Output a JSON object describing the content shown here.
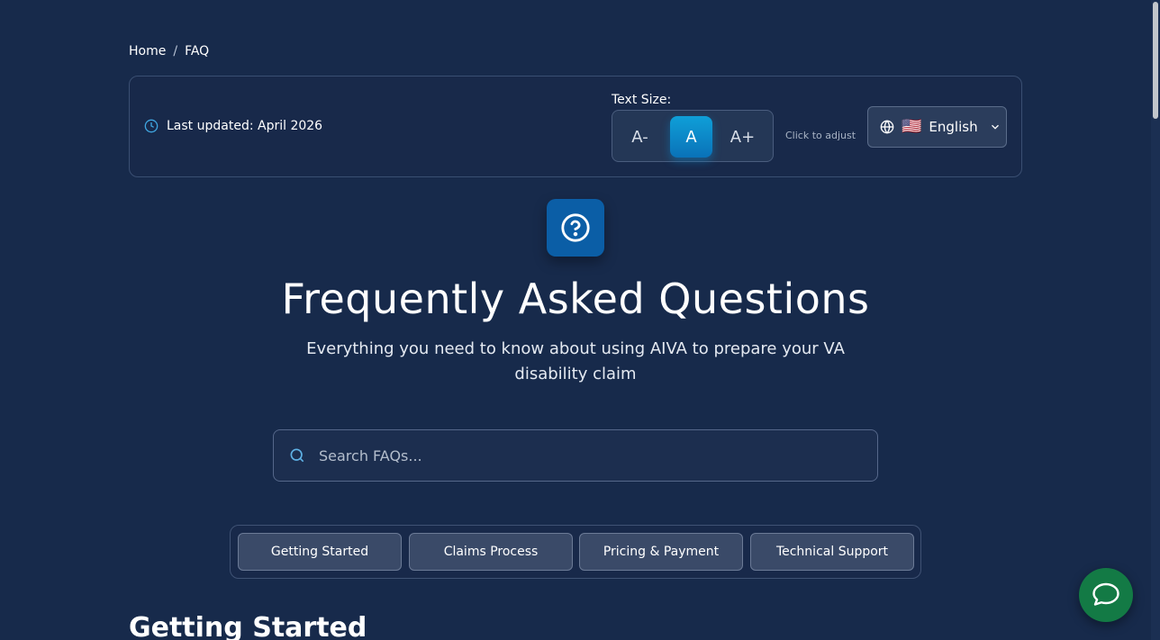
{
  "breadcrumb": {
    "home": "Home",
    "separator": "/",
    "current": "FAQ"
  },
  "topbar": {
    "last_updated": "Last updated: April 2026",
    "text_size_label": "Text Size:",
    "text_size_buttons": [
      {
        "label": "A-"
      },
      {
        "label": "A",
        "active": true
      },
      {
        "label": "A+"
      }
    ],
    "click_hint": "Click to adjust",
    "language": {
      "flag": "🇺🇸",
      "label": "English"
    }
  },
  "hero": {
    "icon": "question-circle-icon",
    "title": "Frequently Asked Questions",
    "subtitle": "Everything you need to know about using AIVA to prepare your VA disability claim"
  },
  "search": {
    "placeholder": "Search FAQs...",
    "value": ""
  },
  "tabs": [
    {
      "label": "Getting Started"
    },
    {
      "label": "Claims Process"
    },
    {
      "label": "Pricing & Payment"
    },
    {
      "label": "Technical Support"
    }
  ],
  "section": {
    "title": "Getting Started"
  },
  "colors": {
    "background": "#172a4b",
    "accent": "#0f9fd8",
    "hero_icon_bg": "#0b5ea6",
    "chat_fab": "#137a45"
  }
}
